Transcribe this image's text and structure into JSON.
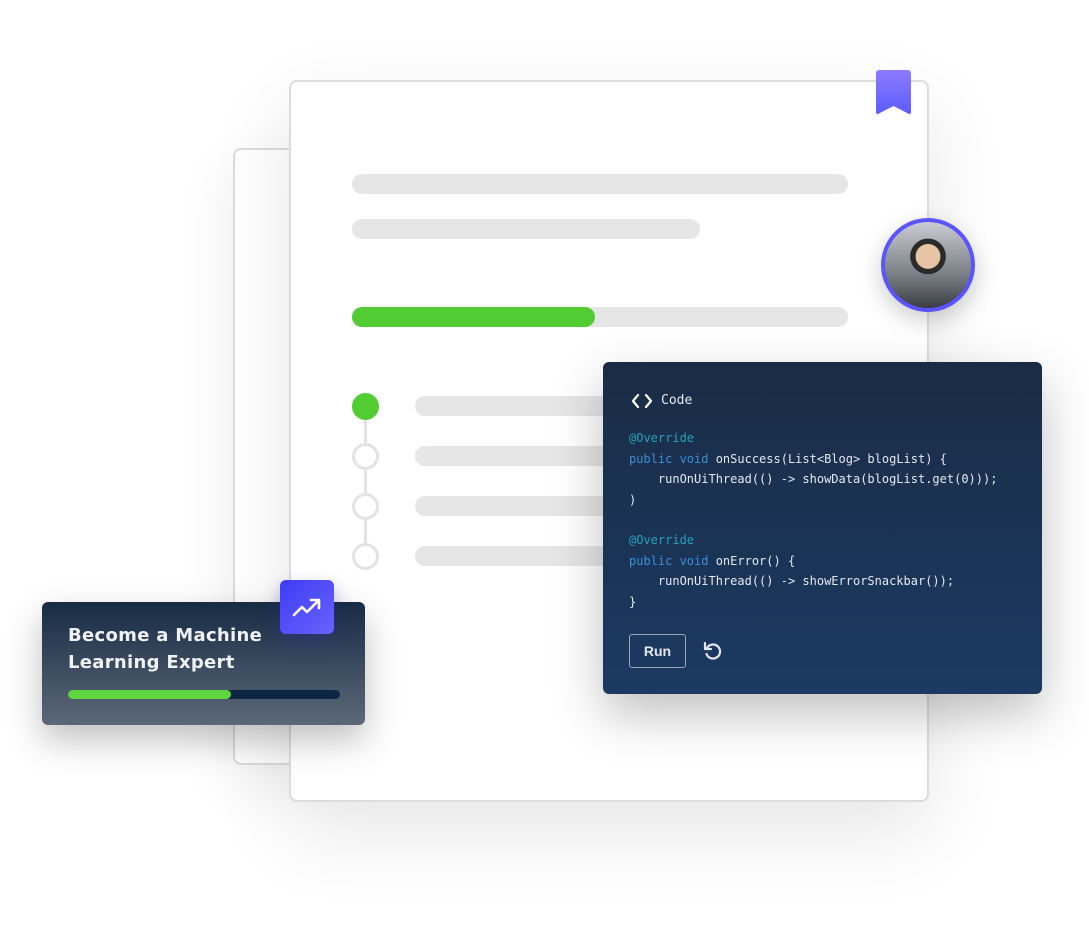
{
  "course_progress": {
    "percent": 49
  },
  "steps": [
    {
      "done": true
    },
    {
      "done": false
    },
    {
      "done": false
    },
    {
      "done": false
    }
  ],
  "code_panel": {
    "title": "Code",
    "icon": "code-brackets-icon",
    "lines": [
      {
        "ann": "@Override"
      },
      {
        "kw": "public void",
        "text": " onSuccess(List<Blog> blogList) {"
      },
      {
        "text": "    runOnUiThread(() -> showData(blogList.get(0)));"
      },
      {
        "text": ")"
      },
      {
        "text": ""
      },
      {
        "ann": "@Override"
      },
      {
        "kw": "public void",
        "text": " onError() {"
      },
      {
        "text": "    runOnUiThread(() -> showErrorSnackbar());"
      },
      {
        "text": "}"
      }
    ],
    "run_label": "Run",
    "reset_icon": "reset-icon"
  },
  "goal_card": {
    "title_line1": "Become a Machine",
    "title_line2": "Learning Expert",
    "progress_percent": 60,
    "icon": "trending-up-icon"
  },
  "colors": {
    "accent": "#5a55ff",
    "progress": "#52cc33",
    "code_bg": "#1b3a63"
  }
}
